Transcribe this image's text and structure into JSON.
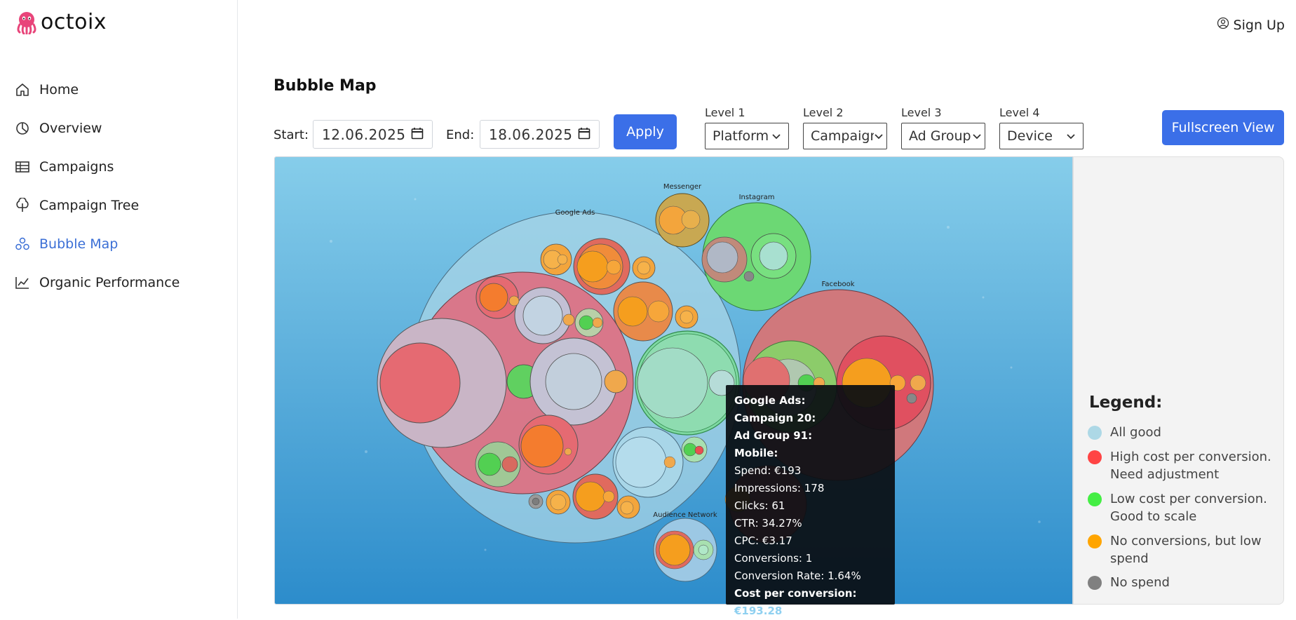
{
  "app": {
    "logo_text": "octoix",
    "sign_up": "Sign Up"
  },
  "sidebar": {
    "items": [
      {
        "label": "Home",
        "icon": "home-icon"
      },
      {
        "label": "Overview",
        "icon": "pie-chart-icon"
      },
      {
        "label": "Campaigns",
        "icon": "table-icon"
      },
      {
        "label": "Campaign Tree",
        "icon": "tree-icon"
      },
      {
        "label": "Bubble Map",
        "icon": "bubbles-icon",
        "active": true
      },
      {
        "label": "Organic Performance",
        "icon": "line-chart-icon"
      }
    ]
  },
  "page": {
    "title": "Bubble Map"
  },
  "filters": {
    "start_label": "Start:",
    "start_value": "12.06.2025",
    "end_label": "End:",
    "end_value": "18.06.2025",
    "apply": "Apply",
    "levels": [
      {
        "label": "Level 1",
        "value": "Platform"
      },
      {
        "label": "Level 2",
        "value": "Campaign"
      },
      {
        "label": "Level 3",
        "value": "Ad Group"
      },
      {
        "label": "Level 4",
        "value": "Device"
      }
    ],
    "fullscreen": "Fullscreen View"
  },
  "bubble_labels": {
    "google_ads": "Google Ads",
    "messenger": "Messenger",
    "instagram": "Instagram",
    "facebook": "Facebook",
    "audience_network": "Audience Network"
  },
  "tooltip": {
    "platform": "Google Ads:",
    "campaign": "Campaign 20:",
    "ad_group": "Ad Group 91:",
    "device": "Mobile:",
    "spend": "Spend: €193",
    "impressions": "Impressions: 178",
    "clicks": "Clicks: 61",
    "ctr": "CTR: 34.27%",
    "cpc": "CPC: €3.17",
    "conversions": "Conversions: 1",
    "conversion_rate": "Conversion Rate: 1.64%",
    "cpa_label": "Cost per conversion:",
    "cpa_value": "€193.28"
  },
  "legend": {
    "title": "Legend:",
    "items": [
      {
        "label": "All good",
        "color": "#add8e6"
      },
      {
        "label": "High cost per conversion. Need adjustment",
        "color": "#ff4444"
      },
      {
        "label": "Low cost per conversion. Good to scale",
        "color": "#44ee44"
      },
      {
        "label": "No conversions, but low spend",
        "color": "#ffa500"
      },
      {
        "label": "No spend",
        "color": "#808080"
      }
    ]
  },
  "colors": {
    "accent": "#3b6fe8",
    "active_nav": "#3b6fd6"
  }
}
